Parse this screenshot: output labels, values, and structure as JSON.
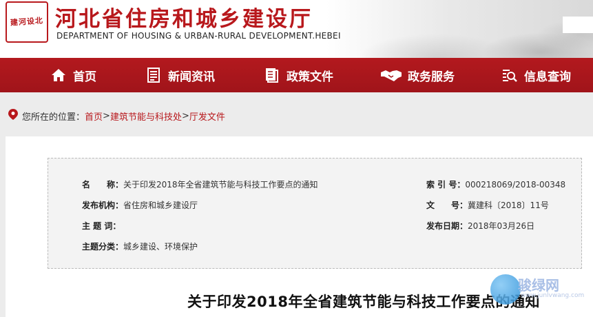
{
  "header": {
    "seal_text": "建河设北",
    "title_cn": "河北省住房和城乡建设厅",
    "title_en": "DEPARTMENT OF HOUSING & URBAN-RURAL DEVELOPMENT.HEBEI"
  },
  "nav": {
    "items": [
      {
        "label": "首页",
        "icon": "home-icon"
      },
      {
        "label": "新闻资讯",
        "icon": "news-icon"
      },
      {
        "label": "政策文件",
        "icon": "document-icon"
      },
      {
        "label": "政务服务",
        "icon": "handshake-icon"
      },
      {
        "label": "信息查询",
        "icon": "search-icon"
      }
    ]
  },
  "breadcrumb": {
    "prefix": "您所在的位置：",
    "items": [
      "首页",
      "建筑节能与科技处",
      "厅发文件"
    ],
    "separator": ">"
  },
  "info": {
    "name_label": "名　　称：",
    "name_value": "关于印发2018年全省建筑节能与科技工作要点的通知",
    "index_label": "索 引 号：",
    "index_value": "000218069/2018-00348",
    "org_label": "发布机构：",
    "org_value": "省住房和城乡建设厅",
    "docno_label": "文　　号：",
    "docno_value": "冀建科〔2018〕11号",
    "topic_label": "主 题 词：",
    "topic_value": "",
    "date_label": "发布日期：",
    "date_value": "2018年03月26日",
    "category_label": "主题分类：",
    "category_value": "城乡建设、环境保护"
  },
  "document": {
    "title": "关于印发2018年全省建筑节能与科技工作要点的通知"
  },
  "watermark": {
    "text": "骏绿网",
    "sub": "www.junlvwang.com"
  },
  "colors": {
    "brand_red": "#b8181c",
    "nav_red": "#a7161b"
  }
}
